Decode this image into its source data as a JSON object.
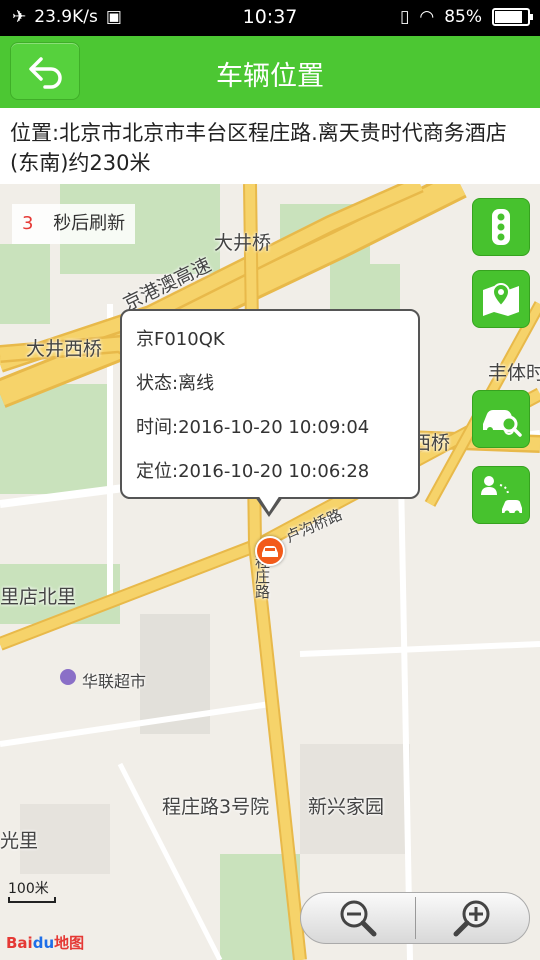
{
  "status_bar": {
    "speed": "23.9K/s",
    "time": "10:37",
    "battery": "85%",
    "battery_level": 0.85
  },
  "header": {
    "title": "车辆位置"
  },
  "address": {
    "text": "位置:北京市北京市丰台区程庄路.离天贵时代商务酒店(东南)约230米"
  },
  "refresh": {
    "countdown": "3",
    "label": "秒后刷新"
  },
  "popup": {
    "plate": "京F010QK",
    "status": "状态:离线",
    "time": "时间:2016-10-20 10:09:04",
    "location_time": "定位:2016-10-20 10:06:28"
  },
  "map_labels": {
    "dajingqiao": "大井桥",
    "jinggangao": "京港澳高速",
    "dajingxiqiao": "大井西桥",
    "fengti": "丰体时",
    "qiao": "西桥",
    "lugouqiao": "卢沟桥路",
    "chengzhuanglu": "程庄路",
    "lidian": "里店北里",
    "hualian": "华联超市",
    "chengzhuang3": "程庄路3号院",
    "xinxing": "新兴家园",
    "guangli": "光里"
  },
  "scale": {
    "label": "100米"
  },
  "logo": {
    "bai": "Bai",
    "du": "du",
    "ditu": "地图"
  },
  "icons": {
    "back": "back-arrow-icon",
    "traffic": "traffic-light-icon",
    "map_type": "map-pin-icon",
    "search_car": "car-search-icon",
    "person_car": "person-car-icon",
    "zoom_out": "zoom-out-icon",
    "zoom_in": "zoom-in-icon"
  },
  "colors": {
    "accent": "#4cc733",
    "marker": "#f25a1a",
    "refresh_number": "#e53935"
  }
}
